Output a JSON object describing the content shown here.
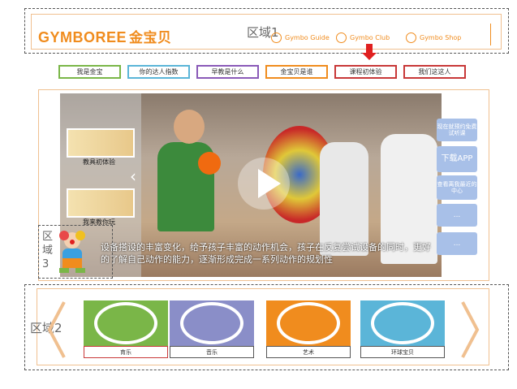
{
  "header": {
    "logo_en": "GYMBOREE",
    "logo_cn": "金宝贝",
    "region_label": "区域1",
    "links": [
      {
        "label": "Gymbo Guide",
        "icon": "guide-icon"
      },
      {
        "label": "Gymbo Club",
        "icon": "club-icon"
      },
      {
        "label": "Gymbo Shop",
        "icon": "shop-icon"
      }
    ],
    "accent": "#f08c1e"
  },
  "tabs": [
    {
      "label": "我是金宝",
      "color": "#7ab648"
    },
    {
      "label": "你的达人指数",
      "color": "#5bb5d8"
    },
    {
      "label": "早教是什么",
      "color": "#8a5ab8"
    },
    {
      "label": "金宝贝是谁",
      "color": "#f08c1e"
    },
    {
      "label": "课程初体验",
      "color": "#c83838"
    },
    {
      "label": "我们这这人",
      "color": "#c83838"
    }
  ],
  "video": {
    "thumbs": [
      {
        "label": "教具初体验"
      },
      {
        "label": "我来教你玩"
      }
    ],
    "caption": "设备搭设的丰富变化，给予孩子丰富的动作机会，孩子在反复尝试设备的同时，更好的了解自己动作的能力，逐渐形成完成一系列动作的规划性",
    "side_boxes": [
      {
        "label": "现在就预约免费试听课"
      },
      {
        "label": "下载APP"
      },
      {
        "label": "查看离我最近的中心"
      },
      {
        "label": "..."
      },
      {
        "label": "..."
      }
    ]
  },
  "region3": {
    "label": "区域3"
  },
  "region2": {
    "label": "区域2",
    "cards": [
      {
        "label": "育乐",
        "color": "#7ab648",
        "icon": "sport-icon"
      },
      {
        "label": "音乐",
        "color": "#8a8ec8",
        "icon": "music-icon"
      },
      {
        "label": "艺术",
        "color": "#f08c1e",
        "icon": "brush-icon"
      },
      {
        "label": "环球宝贝",
        "color": "#5bb5d8",
        "icon": "globe-icon"
      }
    ]
  }
}
